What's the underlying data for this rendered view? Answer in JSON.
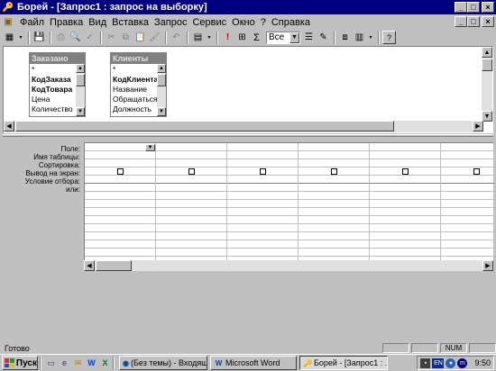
{
  "window": {
    "title": "Борей - [Запрос1 : запрос на выборку]",
    "buttons": {
      "minimize": "_",
      "maximize": "□",
      "close": "×"
    }
  },
  "menu": {
    "items": [
      "Файл",
      "Правка",
      "Вид",
      "Вставка",
      "Запрос",
      "Сервис",
      "Окно",
      "?",
      "Справка"
    ]
  },
  "toolbar": {
    "topvalues_value": "Все"
  },
  "tables": [
    {
      "name": "Заказано",
      "fields": [
        {
          "label": "*",
          "key": false
        },
        {
          "label": "КодЗаказа",
          "key": true
        },
        {
          "label": "КодТовара",
          "key": true
        },
        {
          "label": "Цена",
          "key": false
        },
        {
          "label": "Количество",
          "key": false
        }
      ]
    },
    {
      "name": "Клиенты",
      "fields": [
        {
          "label": "*",
          "key": false
        },
        {
          "label": "КодКлиента",
          "key": true
        },
        {
          "label": "Название",
          "key": false
        },
        {
          "label": "ОбращатьсяК",
          "key": false
        },
        {
          "label": "Должность",
          "key": false
        }
      ]
    }
  ],
  "design_grid": {
    "row_labels": [
      "Поле:",
      "Имя таблицы:",
      "Сортировка:",
      "Вывод на экран:",
      "Условие отбора:",
      "или:"
    ],
    "columns": 6,
    "show_checked": [
      false,
      false,
      false,
      false,
      false,
      false
    ]
  },
  "statusbar": {
    "text": "Готово",
    "num": "NUM"
  },
  "taskbar": {
    "start_label": "Пуск",
    "tasks": [
      {
        "label": "(Без темы) - Входящ...",
        "active": false
      },
      {
        "label": "Microsoft Word",
        "active": false
      },
      {
        "label": "Борей - [Запрос1 : ...",
        "active": true
      }
    ],
    "tray": {
      "lang": "EN",
      "clock": "9:50"
    }
  }
}
